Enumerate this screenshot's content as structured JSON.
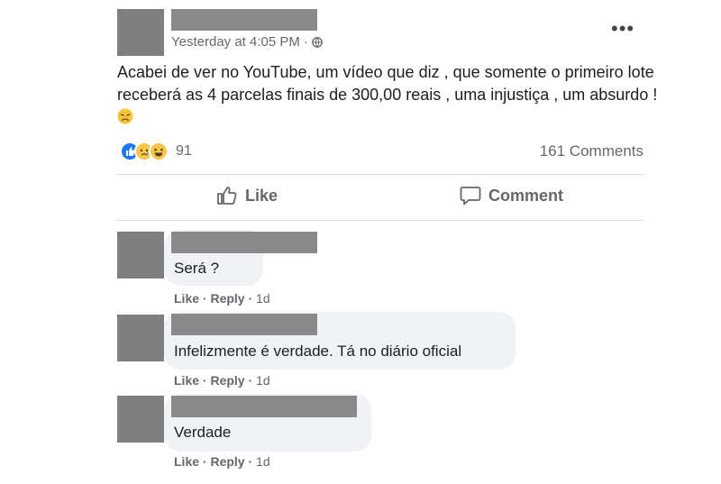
{
  "post": {
    "timestamp": "Yesterday at 4:05 PM · ",
    "more_label": "•••",
    "text": "Acabei de ver no YouTube, um vídeo que diz , que somente o primeiro lote receberá as 4 parcelas finais de 300,00 reais , uma injustiça , um absurdo !",
    "reaction_count": "91",
    "comments_count": "161 Comments"
  },
  "actions": {
    "like_label": "Like",
    "comment_label": "Comment"
  },
  "comments": [
    {
      "text": "Será ?",
      "like": "Like",
      "reply": "Reply",
      "time": "1d"
    },
    {
      "text": "Infelizmente é verdade. Tá no diário oficial",
      "like": "Like",
      "reply": "Reply",
      "time": "1d"
    },
    {
      "text": "Verdade",
      "like": "Like",
      "reply": "Reply",
      "time": "1d"
    }
  ],
  "colors": {
    "like_blue": "#1877f2",
    "redaction_gray": "#808080",
    "bubble_bg": "#f0f2f5"
  },
  "icons": [
    "globe-icon",
    "more-icon",
    "like-reaction-icon",
    "sad-reaction-icon",
    "haha-reaction-icon",
    "thumbs-up-icon",
    "comment-bubble-icon",
    "tired-face-emoji"
  ]
}
